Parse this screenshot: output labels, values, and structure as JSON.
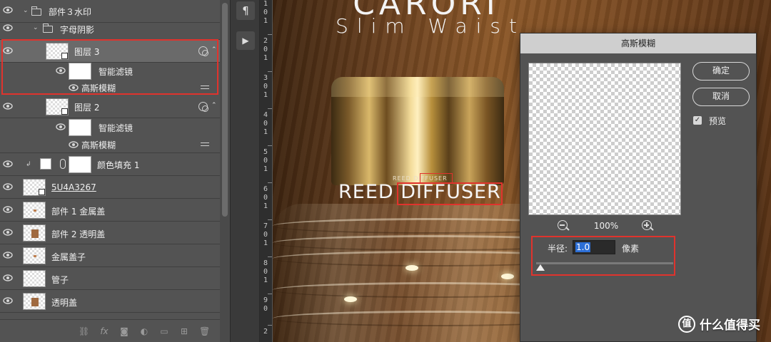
{
  "layers_panel": {
    "rows": [
      {
        "name": "部件３水印",
        "kind": "group"
      },
      {
        "name": "字母阴影",
        "kind": "group"
      },
      {
        "name": "图层 3",
        "kind": "smart-object",
        "selected": true
      },
      {
        "name": "智能滤镜",
        "kind": "filter-mask"
      },
      {
        "name": "高斯模糊",
        "kind": "filter"
      },
      {
        "name": "图层 2",
        "kind": "smart-object"
      },
      {
        "name": "智能滤镜",
        "kind": "filter-mask"
      },
      {
        "name": "高斯模糊",
        "kind": "filter"
      },
      {
        "name": "颜色填充 1",
        "kind": "fill"
      },
      {
        "name": "5U4A3267",
        "kind": "smart-object"
      },
      {
        "name": "部件 1 金属盖",
        "kind": "layer"
      },
      {
        "name": "部件 2 透明盖",
        "kind": "layer"
      },
      {
        "name": "金属盖子",
        "kind": "layer"
      },
      {
        "name": "管子",
        "kind": "layer"
      },
      {
        "name": "透明盖",
        "kind": "layer"
      }
    ],
    "footer_icons": [
      "link-icon",
      "fx-icon",
      "mask-icon",
      "adjustment-icon",
      "folder-icon",
      "new-layer-icon",
      "trash-icon"
    ],
    "fx_label": "fx"
  },
  "ruler": {
    "numbers": [
      "1",
      "0",
      "1",
      "2",
      "0",
      "1",
      "3",
      "0",
      "1",
      "4",
      "0",
      "1",
      "5",
      "0",
      "1",
      "6",
      "0",
      "1",
      "7",
      "0",
      "1",
      "8",
      "0",
      "1",
      "9",
      "0",
      "2"
    ]
  },
  "canvas": {
    "brand": "CARORI",
    "tagline": "Slim Waist",
    "cap_small_text": "REED DIFFUSER",
    "product_text": "REED DIFFUSER"
  },
  "dialog": {
    "title": "高斯模糊",
    "ok_label": "确定",
    "cancel_label": "取消",
    "preview_label": "预览",
    "preview_checked": true,
    "zoom": "100%",
    "radius_label": "半径:",
    "radius_value": "1.0",
    "radius_unit": "像素"
  },
  "watermark": {
    "badge": "值",
    "text": "什么值得买"
  },
  "colors": {
    "panel_bg": "#535353",
    "highlight_red": "#e0332d",
    "selection_blue": "#2d6fd6"
  }
}
